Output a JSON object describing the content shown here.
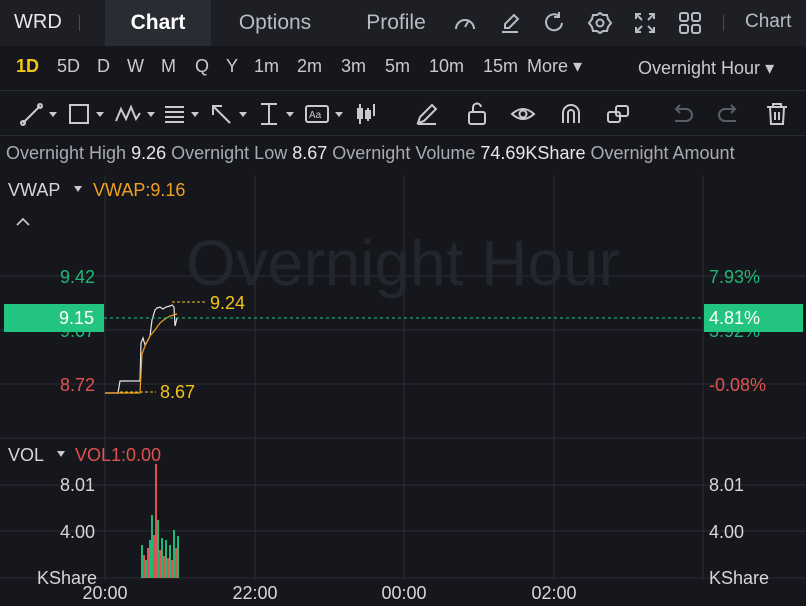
{
  "header": {
    "ticker": "WRD",
    "tabs": [
      {
        "label": "Chart",
        "active": true
      },
      {
        "label": "Options",
        "active": false
      },
      {
        "label": "Profile",
        "active": false
      }
    ],
    "icons": [
      "gauge-icon",
      "edit-icon",
      "refresh-icon",
      "settings-icon",
      "fullscreen-icon",
      "layout-grid-icon"
    ],
    "chart_link": "Chart"
  },
  "periods": {
    "items": [
      "1D",
      "5D",
      "D",
      "W",
      "M",
      "Q",
      "Y",
      "1m",
      "2m",
      "3m",
      "5m",
      "10m",
      "15m"
    ],
    "active": "1D",
    "more_label": "More",
    "session_label": "Overnight Hour"
  },
  "drawing_tools": [
    "trend-line-icon",
    "rectangle-icon",
    "pattern-icon",
    "fib-icon",
    "arrow-icon",
    "vertical-measure-icon",
    "text-icon",
    "candle-icon",
    "pencil-icon",
    "unlock-icon",
    "eye-icon",
    "magnet-icon",
    "layers-icon",
    "undo-icon",
    "redo-icon",
    "trash-icon"
  ],
  "stats": {
    "high_label": "Overnight High",
    "high_value": "9.26",
    "low_label": "Overnight Low",
    "low_value": "8.67",
    "volume_label": "Overnight Volume",
    "volume_value": "74.69KShare",
    "amount_label": "Overnight Amount"
  },
  "price_panel": {
    "indicator_name": "VWAP",
    "indicator_value": "VWAP:9.16",
    "watermark": "Overnight Hour",
    "left_ticks": [
      "9.42",
      "9.07",
      "8.72"
    ],
    "right_ticks": [
      "7.93%",
      "3.92%",
      "-0.08%"
    ],
    "current_price": "9.15",
    "current_pct": "4.81%",
    "high_marker": "9.24",
    "low_marker": "8.67"
  },
  "volume_panel": {
    "indicator_name": "VOL",
    "indicator_value": "VOL1:0.00",
    "left_ticks": [
      "8.01",
      "4.00"
    ],
    "right_ticks": [
      "8.01",
      "4.00"
    ],
    "unit_left": "KShare",
    "unit_right": "KShare"
  },
  "time_axis": [
    "20:00",
    "22:00",
    "00:00",
    "02:00"
  ],
  "colors": {
    "accent": "#f3c316",
    "up": "#1fb877",
    "down": "#e0524f",
    "price_line": "#e6e7ea",
    "vwap_line": "#f0a020",
    "current_badge": "#22c47f"
  },
  "chart_data": {
    "type": "line",
    "title": "",
    "x": [
      "20:00",
      "22:00",
      "00:00",
      "02:00"
    ],
    "series": [
      {
        "name": "VWAP",
        "values_hint": "9.16"
      }
    ],
    "price_ylim": [
      8.72,
      9.42
    ],
    "volume_ylim": [
      0,
      8.01
    ],
    "grid": true
  }
}
